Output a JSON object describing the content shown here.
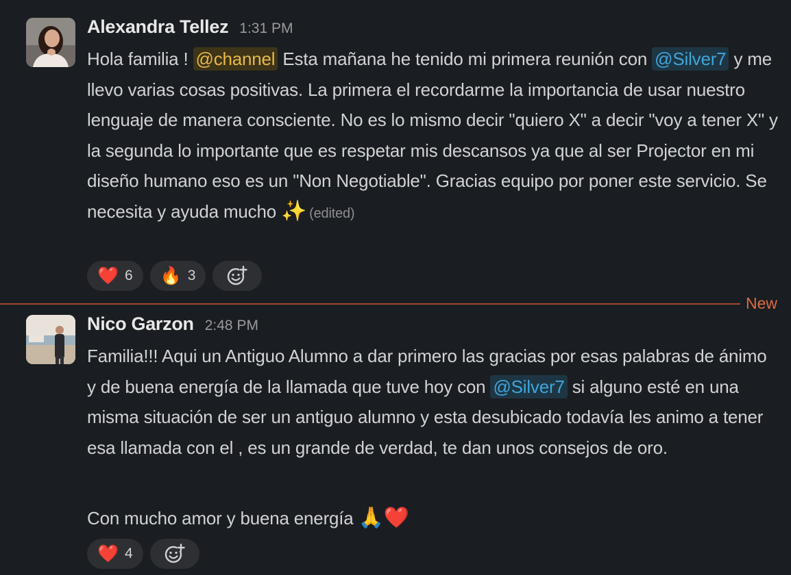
{
  "messages": [
    {
      "author": "Alexandra Tellez",
      "time": "1:31 PM",
      "text_start": "Hola familia ! ",
      "mention_channel": "@channel",
      "text_a": " Esta mañana he tenido mi primera reunión con ",
      "mention_user": "@Silver7",
      "text_b": " y me llevo varias cosas positivas. La primera el recordarme la importancia de usar nuestro lenguaje de manera consciente. No es lo mismo decir \"quiero X\" a decir \"voy a tener X\" y la segunda lo importante que es respetar mis descansos ya que al ser Projector en mi diseño humano eso es un \"Non Negotiable\". Gracias equipo por poner este servicio. Se necesita y ayuda mucho ",
      "emoji_end": "✨",
      "edited": "(edited)",
      "reactions": [
        {
          "emoji": "❤️",
          "count": "6"
        },
        {
          "emoji": "🔥",
          "count": "3"
        }
      ]
    },
    {
      "author": "Nico Garzon",
      "time": "2:48 PM",
      "text_a": "Familia!!! Aqui un Antiguo Alumno a dar primero las gracias por esas palabras de ánimo y de buena energía de la llamada que tuve hoy con ",
      "mention_user": "@Silver7",
      "text_b": " si alguno esté en una misma situación de ser un antiguo alumno y esta desubicado todavía les animo a tener esa llamada con el , es un grande de verdad, te dan unos consejos de oro.",
      "text_c": "Con mucho amor y buena energía ",
      "emoji_end": "🙏❤️",
      "reactions": [
        {
          "emoji": "❤️",
          "count": "4"
        }
      ]
    }
  ],
  "divider_label": "New",
  "icons": {
    "add_reaction": "add-emoji-icon"
  },
  "colors": {
    "background": "#1a1d21",
    "mention_user": "#3fa6db",
    "mention_channel": "#e8b94a",
    "new_divider": "#dd6b43"
  }
}
